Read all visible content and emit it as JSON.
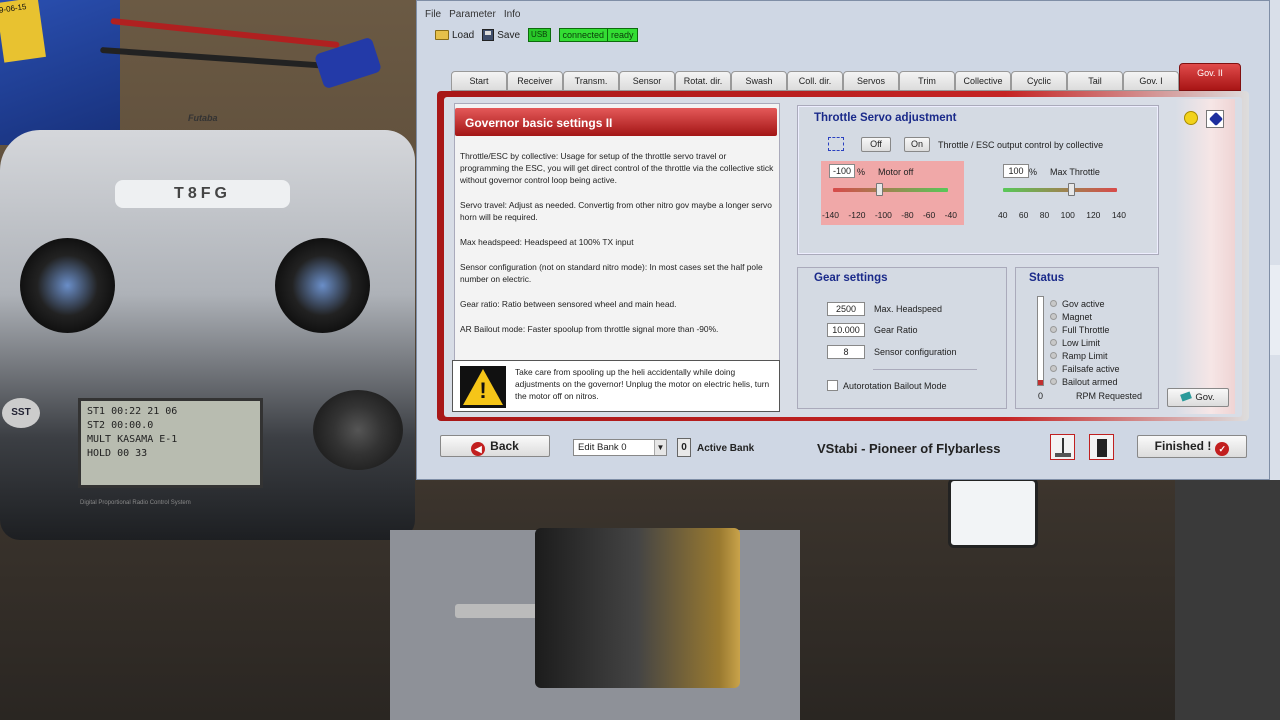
{
  "backdrop": {
    "battery_label": "9-06-15",
    "radio_brand": "Futaba",
    "radio_model": "T8FG",
    "radio_lcd": [
      "ST1 00:22 21 06",
      "ST2 00:00.0",
      "MULT KASAMA E-1",
      "HOLD 00 33"
    ],
    "radio_caption": "Digital Proportional Radio Control System",
    "radio_logo": "SST"
  },
  "app": {
    "menu": [
      "File",
      "Parameter",
      "Info"
    ],
    "toolbar": {
      "load": "Load",
      "save": "Save",
      "usb": "USB",
      "conn_status": "connected",
      "ready_status": "ready"
    },
    "tabs": [
      "Start",
      "Receiver",
      "Transm.",
      "Sensor",
      "Rotat. dir.",
      "Swash",
      "Coll. dir.",
      "Servos",
      "Trim",
      "Collective",
      "Cyclic",
      "Tail",
      "Gov. I",
      "Gov. II"
    ],
    "active_tab": "Gov. II"
  },
  "info": {
    "title": "Governor basic settings II",
    "paragraphs": [
      "Throttle/ESC by collective: Usage for setup of the throttle servo travel or programming the ESC, you will get direct control of the throttle via the collective stick without governor control loop being active.",
      "Servo travel: Adjust as needed. Convertig from other nitro gov maybe a longer servo horn will be required.",
      "Max headspeed: Headspeed at 100% TX input",
      "Sensor configuration (not on standard nitro mode): In most cases set the half pole number on electric.",
      "Gear ratio: Ratio between sensored wheel and main head.",
      "AR Bailout mode: Faster spoolup from throttle signal more than -90%."
    ],
    "warning": "Take care from spooling up the heli accidentally while doing adjustments on the governor! Unplug the motor on electric helis, turn the motor off on nitros."
  },
  "throttle": {
    "title": "Throttle Servo adjustment",
    "off_label": "Off",
    "on_label": "On",
    "control_desc": "Throttle / ESC output control by collective",
    "motor_off_value": "-100",
    "motor_off_label": "Motor off",
    "max_throttle_value": "100",
    "max_throttle_label": "Max Throttle",
    "percent": "%",
    "motor_off_scale": [
      "-140",
      "-120",
      "-100",
      "-80",
      "-60",
      "-40"
    ],
    "max_throttle_scale": [
      "40",
      "60",
      "80",
      "100",
      "120",
      "140"
    ],
    "motor_off_level": -100,
    "max_throttle_level": 100
  },
  "gear": {
    "title": "Gear settings",
    "headspeed_value": "2500",
    "headspeed_label": "Max. Headspeed",
    "ratio_value": "10.000",
    "ratio_label": "Gear Ratio",
    "sensor_value": "8",
    "sensor_label": "Sensor configuration",
    "bailout_label": "Autorotation Bailout Mode"
  },
  "status": {
    "title": "Status",
    "items": [
      "Gov active",
      "Magnet",
      "Full Throttle",
      "Low Limit",
      "Ramp Limit",
      "Failsafe active",
      "Bailout armed"
    ],
    "rpm_value": "0",
    "rpm_label": "RPM Requested",
    "gov_button": "Gov."
  },
  "bottom": {
    "back": "Back",
    "bank_select": "Edit Bank 0",
    "active_bank_num": "0",
    "active_bank_label": "Active Bank",
    "slogan": "VStabi - Pioneer of Flybarless",
    "finished": "Finished !"
  },
  "colors": {
    "accent_red": "#c52424",
    "title_blue": "#1a2a8a",
    "status_green": "#33dd33"
  }
}
